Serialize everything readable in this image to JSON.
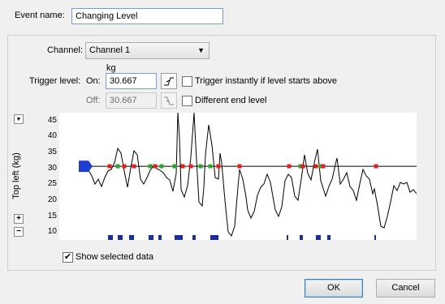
{
  "event_name": {
    "label": "Event name:",
    "value": "Changing Level"
  },
  "channel": {
    "label": "Channel:",
    "selected": "Channel 1"
  },
  "unit": "kg",
  "trigger": {
    "label": "Trigger level:",
    "on_label": "On:",
    "on_value": "30.667",
    "off_label": "Off:",
    "off_value": "30.667",
    "instant_label": "Trigger instantly if level starts above",
    "different_end_label": "Different end level"
  },
  "axis": {
    "ylabel": "Top left (kg)",
    "ticks": [
      "45",
      "40",
      "35",
      "30",
      "25",
      "20",
      "15",
      "10"
    ]
  },
  "show_selected": {
    "label": "Show selected data",
    "checked": true
  },
  "buttons": {
    "ok": "OK",
    "cancel": "Cancel"
  },
  "colors": {
    "trigger_line": "#000000",
    "handle": "#1f3fcf",
    "marker_red": "#e02020",
    "marker_green": "#30a030",
    "segment": "#1a2f9a"
  }
}
